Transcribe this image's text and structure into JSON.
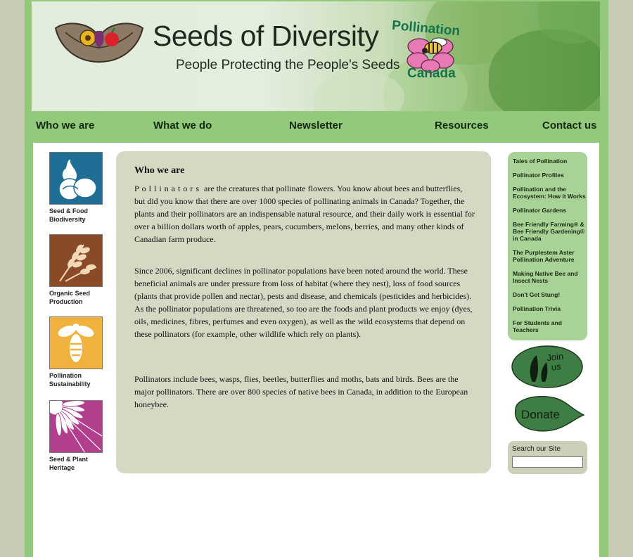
{
  "header": {
    "site_title": "Seeds of Diversity",
    "tagline": "People Protecting the People's Seeds",
    "logo_top_text": "Pollination",
    "logo_bottom_text": "Canada"
  },
  "nav": {
    "items": [
      {
        "label": "Who we are"
      },
      {
        "label": "What we do"
      },
      {
        "label": "Newsletter"
      },
      {
        "label": "Resources"
      },
      {
        "label": "Contact us"
      }
    ]
  },
  "left_menu": {
    "items": [
      {
        "label": "Seed & Food Biodiversity",
        "icon": "vegetables-icon",
        "color": "#1f6e96"
      },
      {
        "label": "Organic Seed Production",
        "icon": "wheat-icon",
        "color": "#8a4a28"
      },
      {
        "label": "Pollination Sustainability",
        "icon": "bee-icon",
        "color": "#f0b13d"
      },
      {
        "label": "Seed & Plant Heritage",
        "icon": "flower-icon",
        "color": "#b23f8e"
      }
    ]
  },
  "main": {
    "heading": "Who we are",
    "p1_first": "Pollinators",
    "p1_rest": " are the creatures that pollinate flowers. You know about bees and butterflies, but did you know that there are over 1000 species of pollinating animals in Canada? Together, the plants and their pollinators are an indispensable natural resource, and their daily work is essential for over a billion dollars worth of apples, pears, cucumbers, melons, berries, and many other kinds of Canadian farm produce.",
    "p2": "Since 2006, significant declines in pollinator populations have been noted around the world. These beneficial animals are under pressure from loss of habitat (where they nest), loss of food sources (plants that provide pollen and nectar), pests and disease, and chemicals (pesticides and herbicides). As the pollinator populations are threatened, so too are the foods and plant products we enjoy (dyes, oils, medicines, fibres, perfumes and even oxygen), as well as the wild ecosystems that depend on these pollinators (for example, other wildlife which rely on plants).",
    "p3": "Pollinators include bees, wasps, flies, beetles, butterflies and moths, bats and birds. Bees are the major pollinators. There are over 800 species of native bees in Canada, in addition to the European honeybee."
  },
  "side_menu": {
    "items": [
      {
        "label": "Tales of Pollination"
      },
      {
        "label": "Pollinator Profiles"
      },
      {
        "label": "Pollination and the Ecosystem: How it Works"
      },
      {
        "label": "Pollinator Gardens"
      },
      {
        "label": "Bee Friendly Farming® & Bee Friendly Gardening® in Canada"
      },
      {
        "label": "The Purplestem Aster Pollination Adventure"
      },
      {
        "label": "Making Native Bee and Insect Nests"
      },
      {
        "label": "Don't Get Stung!"
      },
      {
        "label": "Pollination Trivia"
      },
      {
        "label": "For Students and Teachers"
      }
    ]
  },
  "buttons": {
    "join_label": "Join us",
    "donate_label": "Donate"
  },
  "search": {
    "label": "Search our Site",
    "value": "",
    "placeholder": ""
  },
  "colors": {
    "frame_green": "#93c97a",
    "outer_bg": "#c7cbb3",
    "main_panel": "#d5d8c3",
    "side_menu": "#a9d396",
    "button_green": "#3e7e45"
  }
}
